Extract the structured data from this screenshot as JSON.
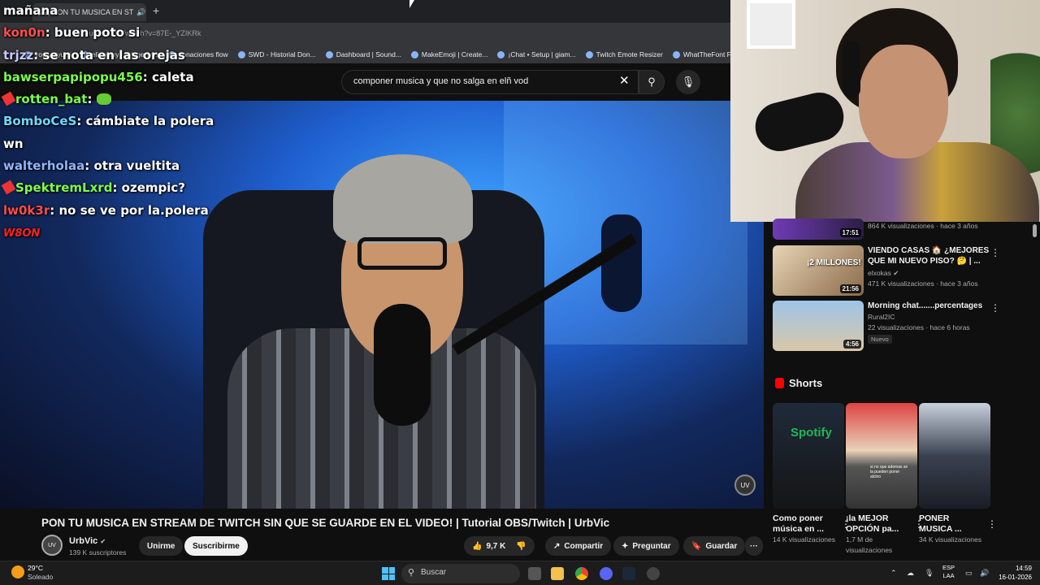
{
  "browser": {
    "tab_title": "(22) PON TU MUSICA EN ST",
    "url": "youtube.com/watch?v=87E-_YZIKRk",
    "bookmarks": [
      "youtyutyuiui",
      "elianoiuy - Triggerfyre",
      "donaciones flow",
      "SWD - Historial Don...",
      "Dashboard | Sound...",
      "MakeEmoji | Create...",
      "¡Chat • Setup | giam...",
      "Twitch Emote Resizer",
      "WhatTheFont Font |..."
    ]
  },
  "search": {
    "query": "componer musica y que no salga en elñ vod"
  },
  "chat": {
    "messages": [
      {
        "user": "",
        "text": "mañana",
        "color": "#ffffff"
      },
      {
        "user": "kon0n",
        "text": "buen poto si",
        "color": "#ff4d4d"
      },
      {
        "user": "trjzz",
        "text": "se nota en las orejas",
        "color": "#c9c9ff"
      },
      {
        "user": "bawserpapipopu456",
        "text": "caleta",
        "color": "#7cff4d"
      },
      {
        "user": "rotten_bat",
        "text": "",
        "color": "#7cff4d",
        "badge": true,
        "emote": true
      },
      {
        "user": "BomboCeS",
        "text": "cámbiate la polera",
        "color": "#6fd9ff"
      },
      {
        "user": "",
        "text": "wn",
        "color": "#ffffff"
      },
      {
        "user": "walterholaa",
        "text": "otra vueltita",
        "color": "#8fb6ff"
      },
      {
        "user": "SpektremLxrd",
        "text": "ozempic?",
        "color": "#7cff4d",
        "badge": true
      },
      {
        "user": "lw0k3r",
        "text": "no se ve por la.polera",
        "color": "#ff4d4d"
      },
      {
        "user": "",
        "text": "W8ON",
        "color": "#ff2222",
        "weon": true
      }
    ]
  },
  "video": {
    "title": "PON TU MUSICA EN STREAM DE TWITCH SIN QUE SE GUARDE EN EL VIDEO! | Tutorial OBS/Twitch | UrbVic",
    "channel": "UrbVic",
    "subscribers": "139 K suscriptores",
    "join_label": "Unirme",
    "subscribe_label": "Suscribirme",
    "likes": "9,7 K",
    "share_label": "Compartir",
    "ask_label": "Preguntar",
    "save_label": "Guardar"
  },
  "recommendations": [
    {
      "title": "",
      "channel": "",
      "meta": "864 K visualizaciones · hace 3 años",
      "duration": "17:51"
    },
    {
      "title": "VIENDO CASAS 🏠 ¿MEJORES QUE MI NUEVO PISO? 🤔 | ...",
      "channel": "elxokas",
      "meta": "471 K visualizaciones · hace 3 años",
      "duration": "21:56",
      "thumb_text": "¡2 MILLONES!"
    },
    {
      "title": "Morning chat.......percentages",
      "channel": "Rural2IC",
      "meta": "22 visualizaciones · hace 6 horas",
      "duration": "4:56",
      "badge": "Nuevo"
    }
  ],
  "shorts": {
    "heading": "Shorts",
    "items": [
      {
        "title": "Como poner música en ...",
        "views": "14 K visualizaciones",
        "thumb_text": "Spotify"
      },
      {
        "title": "¡la MEJOR OPCIÓN pa...",
        "views": "1,7 M de visualizaciones",
        "thumb_text": "si no que ademas se la pueden poner alcino"
      },
      {
        "title": "PONER MUSICA ...",
        "views": "34 K visualizaciones",
        "thumb_text": ""
      }
    ]
  },
  "taskbar": {
    "temp": "29°C",
    "weather": "Soleado",
    "search_label": "Buscar",
    "lang_top": "ESP",
    "lang_bottom": "LAA",
    "time": "14:59",
    "date": "16-01-2026"
  },
  "colors": {
    "youtube_bg": "#0f0f0f",
    "accent_red": "#ff0000",
    "start_blue": "#4cc2ff"
  }
}
